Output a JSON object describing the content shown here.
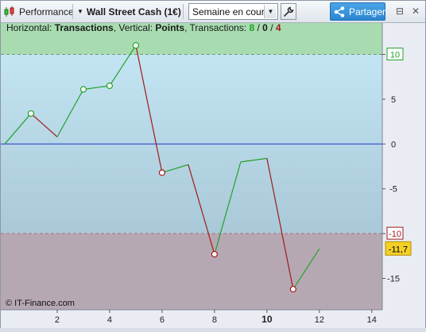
{
  "toolbar": {
    "performance_label": "Performance",
    "instrument_label": "Wall Street Cash (1€)",
    "period_value": "Semaine en cours",
    "share_label": "Partager",
    "minimize_glyph": "⊟",
    "close_glyph": "✕"
  },
  "icons": {
    "chart": "candlestick-chart-icon",
    "dropdown": "chevron-down-icon",
    "settings": "wrench-icon",
    "share": "share-icon",
    "minimize": "minimize-icon",
    "close": "close-icon"
  },
  "colors": {
    "gain": "#22a229",
    "loss": "#a21919",
    "zero_line": "#2133c8",
    "upper_zone": "#a8dcb0",
    "lower_zone": "#b6a8b3",
    "mid_zone": "#b7dbec",
    "current_badge": "#f4cf26"
  },
  "header": {
    "horizontal_prefix": "Horizontal: ",
    "horizontal_value": "Transactions",
    "vertical_prefix": ", Vertical: ",
    "vertical_value": "Points",
    "transactions_prefix": ", Transactions: ",
    "wins": "8",
    "slash1": " / ",
    "neutral": "0",
    "slash2": " / ",
    "losses": "4"
  },
  "watermark": "© IT-Finance.com",
  "chart_data": {
    "type": "line",
    "x": [
      0,
      1,
      2,
      3,
      4,
      5,
      6,
      7,
      8,
      9,
      10,
      11,
      12
    ],
    "y": [
      0,
      3.4,
      0.8,
      6.1,
      6.5,
      11,
      -3.2,
      -2.3,
      -12.3,
      -2,
      -1.6,
      -16.2,
      -11.7
    ],
    "xlim": [
      0,
      14.4
    ],
    "ylim": [
      -18.5,
      13.5
    ],
    "x_ticks": [
      2,
      4,
      6,
      8,
      10,
      12,
      14
    ],
    "x_tick_labels": [
      "2",
      "4",
      "6",
      "8",
      "10",
      "12",
      "14"
    ],
    "x_bold_tick": "10",
    "y_ticks": [
      10,
      5,
      0,
      -5,
      -10,
      -15
    ],
    "y_tick_labels": [
      "10",
      "5",
      "0",
      "-5",
      "-10",
      "-15"
    ],
    "upper_threshold": 10,
    "lower_threshold": -10,
    "current_value": -11.7,
    "current_value_label": "-11,7",
    "loss_segment_markers": [
      1,
      5,
      8,
      11
    ],
    "grid": false
  }
}
